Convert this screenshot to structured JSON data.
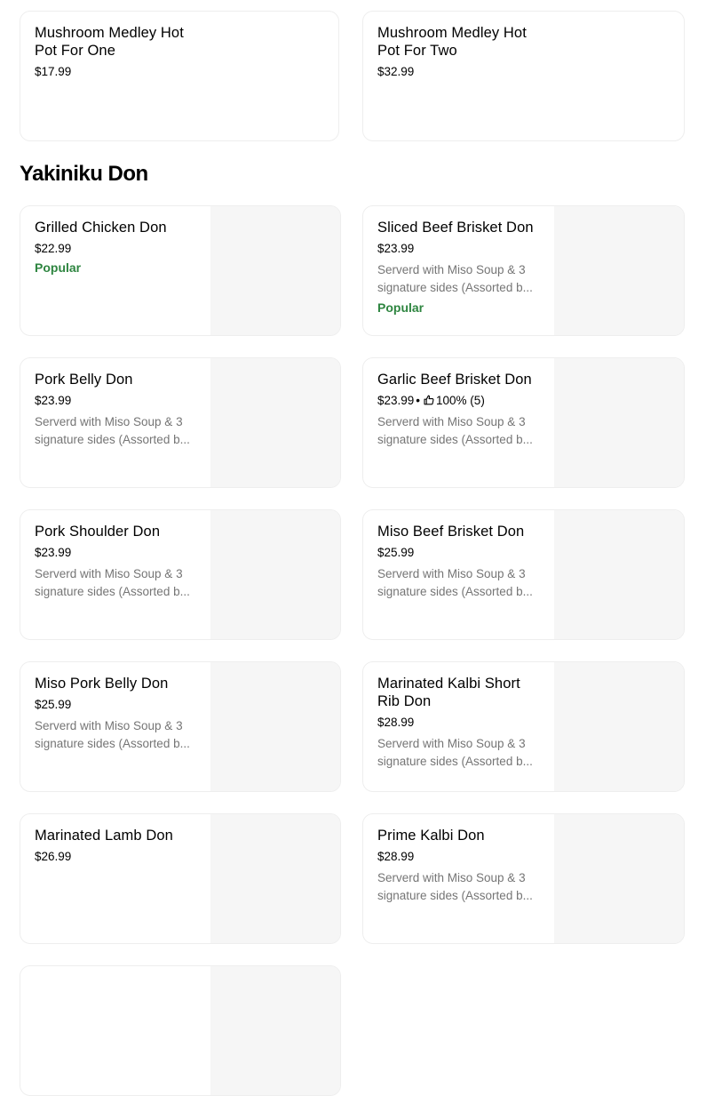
{
  "top_cards": [
    {
      "title_l1": "Mushroom Medley Hot",
      "title_l2": "Pot For One",
      "price": "$17.99"
    },
    {
      "title_l1": "Mushroom Medley Hot",
      "title_l2": "Pot For Two",
      "price": "$32.99"
    }
  ],
  "section": {
    "title": "Yakiniku Don"
  },
  "items": [
    {
      "title": "Grilled Chicken Don",
      "price": "$22.99",
      "badge": "Popular"
    },
    {
      "title": "Sliced Beef Brisket Don",
      "price": "$23.99",
      "desc_l1": "Serverd with Miso Soup & 3",
      "desc_l2": "signature sides (Assorted b...",
      "badge": "Popular"
    },
    {
      "title": "Pork Belly Don",
      "price": "$23.99",
      "desc_l1": "Serverd with Miso Soup & 3",
      "desc_l2": "signature sides (Assorted b..."
    },
    {
      "title": "Garlic Beef Brisket Don",
      "price": "$23.99",
      "sep": "•",
      "rating": "100% (5)",
      "desc_l1": "Serverd with Miso Soup & 3",
      "desc_l2": "signature sides (Assorted b..."
    },
    {
      "title": "Pork Shoulder Don",
      "price": "$23.99",
      "desc_l1": "Serverd with Miso Soup & 3",
      "desc_l2": "signature sides (Assorted b..."
    },
    {
      "title": "Miso Beef Brisket Don",
      "price": "$25.99",
      "desc_l1": "Serverd with Miso Soup & 3",
      "desc_l2": "signature sides (Assorted b..."
    },
    {
      "title": "Miso Pork Belly Don",
      "price": "$25.99",
      "desc_l1": "Serverd with Miso Soup & 3",
      "desc_l2": "signature sides (Assorted b..."
    },
    {
      "title_l1": "Marinated Kalbi Short",
      "title_l2": "Rib Don",
      "price": "$28.99",
      "desc_l1": "Serverd with Miso Soup & 3",
      "desc_l2": "signature sides (Assorted b..."
    },
    {
      "title": "Marinated Lamb Don",
      "price": "$26.99"
    },
    {
      "title": "Prime Kalbi Don",
      "price": "$28.99",
      "desc_l1": "Serverd with Miso Soup & 3",
      "desc_l2": "signature sides (Assorted b..."
    }
  ],
  "icons": {
    "rating": "thumbs-up-icon"
  },
  "colors": {
    "popular": "#2e8540",
    "desc": "#757575",
    "border": "#eeeeee",
    "image_placeholder": "#f6f6f6"
  }
}
